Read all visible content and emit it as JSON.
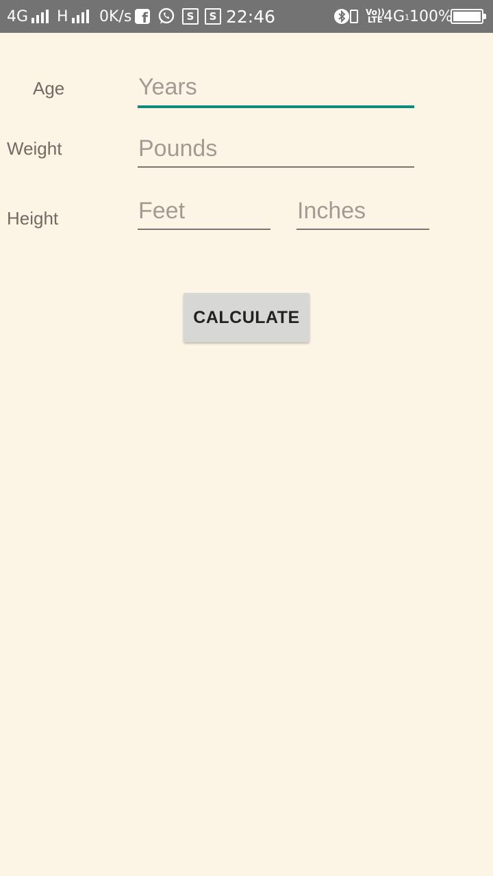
{
  "status_bar": {
    "network1": "4G",
    "network2": "H",
    "speed": "0K/s",
    "time": "22:46",
    "volte_top": "Vo))",
    "volte_bottom": "LTE",
    "network3": "4G",
    "network3_sub": "1",
    "battery": "100%",
    "battery_level": 1.0,
    "app_icons": [
      "facebook-icon",
      "whatsapp-icon",
      "s-app-icon",
      "s-app-icon"
    ],
    "icons": [
      "bluetooth-icon",
      "sim-icon",
      "battery-icon"
    ],
    "s_icon_letter": "S",
    "fb_letter": "f"
  },
  "form": {
    "age_label": "Age",
    "age_placeholder": "Years",
    "weight_label": "Weight",
    "weight_placeholder": "Pounds",
    "height_label": "Height",
    "feet_placeholder": "Feet",
    "inches_placeholder": "Inches",
    "calculate_label": "CALCULATE"
  },
  "colors": {
    "background": "#fcf5e6",
    "status_bar": "#737373",
    "accent": "#0e8a7a",
    "button": "#d7d8d6"
  }
}
